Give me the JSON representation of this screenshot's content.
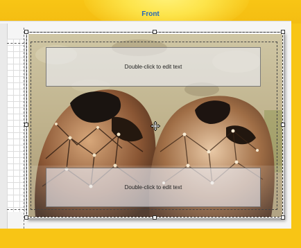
{
  "page_label": "Front",
  "text_placeholders": {
    "top": "Double-click to edit text",
    "bottom": "Double-click to edit text"
  },
  "colors": {
    "background": "#f8c515",
    "page_label": "#2466b8",
    "panel": "#f5f5f5"
  },
  "icons": {
    "cursor": "move-cursor-icon"
  }
}
